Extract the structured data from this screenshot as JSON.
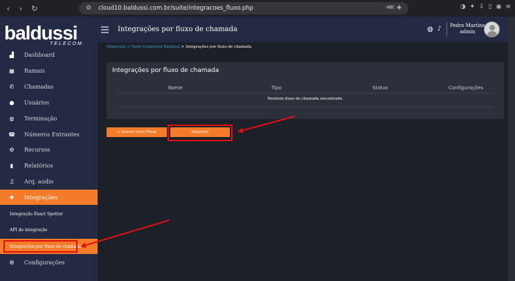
{
  "browser": {
    "url": "cloud10.baldussi.com.br/suite/integracoes_fluxo.php"
  },
  "sidebar": {
    "logo_main": "baldussi",
    "logo_sub": "TELECOM",
    "items": [
      {
        "label": "Dashboard",
        "icon": "chart-icon"
      },
      {
        "label": "Ramais",
        "icon": "grid-icon"
      },
      {
        "label": "Chamadas",
        "icon": "phone-icon"
      },
      {
        "label": "Usuários",
        "icon": "user-icon"
      },
      {
        "label": "Terminação",
        "icon": "globe-icon"
      },
      {
        "label": "Números Entrantes",
        "icon": "phone-hash-icon"
      },
      {
        "label": "Recursos",
        "icon": "gear-group-icon"
      },
      {
        "label": "Relatórios",
        "icon": "clipboard-icon"
      },
      {
        "label": "Arq. audio",
        "icon": "audio-file-icon"
      },
      {
        "label": "Integrações",
        "icon": "puzzle-icon"
      },
      {
        "label": "Configurações",
        "icon": "gear-icon"
      }
    ],
    "sub_items": [
      {
        "label": "Integração Exact Spotter"
      },
      {
        "label": "API de integração"
      },
      {
        "label": "Integrações por fluxo de chamada"
      }
    ]
  },
  "header": {
    "title": "Integrações por fluxo de chamada",
    "user_name": "Pedro Martins",
    "user_role": "admin"
  },
  "breadcrumb": {
    "item1": "Empresas",
    "sep": ">",
    "item2": "Teste Comercial Baldussi",
    "item3": "Integrações por fluxo de chamada"
  },
  "card": {
    "title": "Integrações por fluxo de chamada",
    "columns": [
      "Nome",
      "Tipo",
      "Status",
      "Configurações"
    ],
    "empty_message": "Nenhum fluxo de chamada encontrado."
  },
  "buttons": {
    "insert": "+ Inserir novo Fluxo",
    "import": "Importar"
  },
  "colors": {
    "accent": "#f47b2a",
    "sidebar_bg": "#242a43",
    "highlight": "#e01010"
  }
}
